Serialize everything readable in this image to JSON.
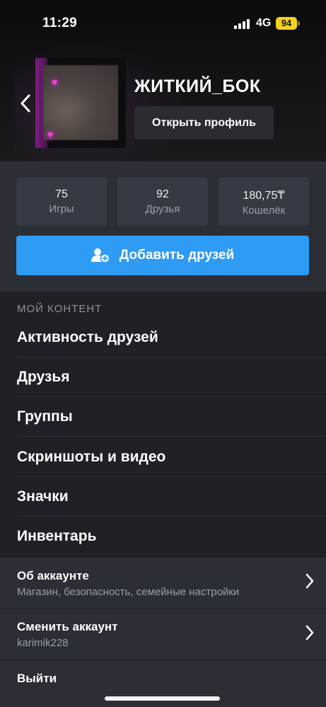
{
  "status_bar": {
    "time": "11:29",
    "network": "4G",
    "battery": "94"
  },
  "profile": {
    "username": "ЖИТКИЙ_БОК",
    "open_profile_label": "Открыть профиль"
  },
  "stats": [
    {
      "value": "75",
      "label": "Игры"
    },
    {
      "value": "92",
      "label": "Друзья"
    },
    {
      "value": "180,75₸",
      "label": "Кошелёк"
    }
  ],
  "add_friends_label": "Добавить друзей",
  "my_content": {
    "title": "МОЙ КОНТЕНТ",
    "items": [
      {
        "label": "Активность друзей"
      },
      {
        "label": "Друзья"
      },
      {
        "label": "Группы"
      },
      {
        "label": "Скриншоты и видео"
      },
      {
        "label": "Значки"
      },
      {
        "label": "Инвентарь"
      }
    ]
  },
  "account": {
    "about": {
      "title": "Об аккаунте",
      "subtitle": "Магазин, безопасность, семейные настройки"
    },
    "switch": {
      "title": "Сменить аккаунт",
      "subtitle": "karimik228"
    },
    "logout": {
      "title": "Выйти"
    }
  },
  "colors": {
    "accent": "#2e9bf5",
    "battery": "#f4d21b",
    "heart": "#ff3fe0"
  },
  "icons": {
    "back": "chevron-left-icon",
    "add_friend": "add-user-icon",
    "chevron": "chevron-right-icon",
    "heart": "heart-icon"
  }
}
